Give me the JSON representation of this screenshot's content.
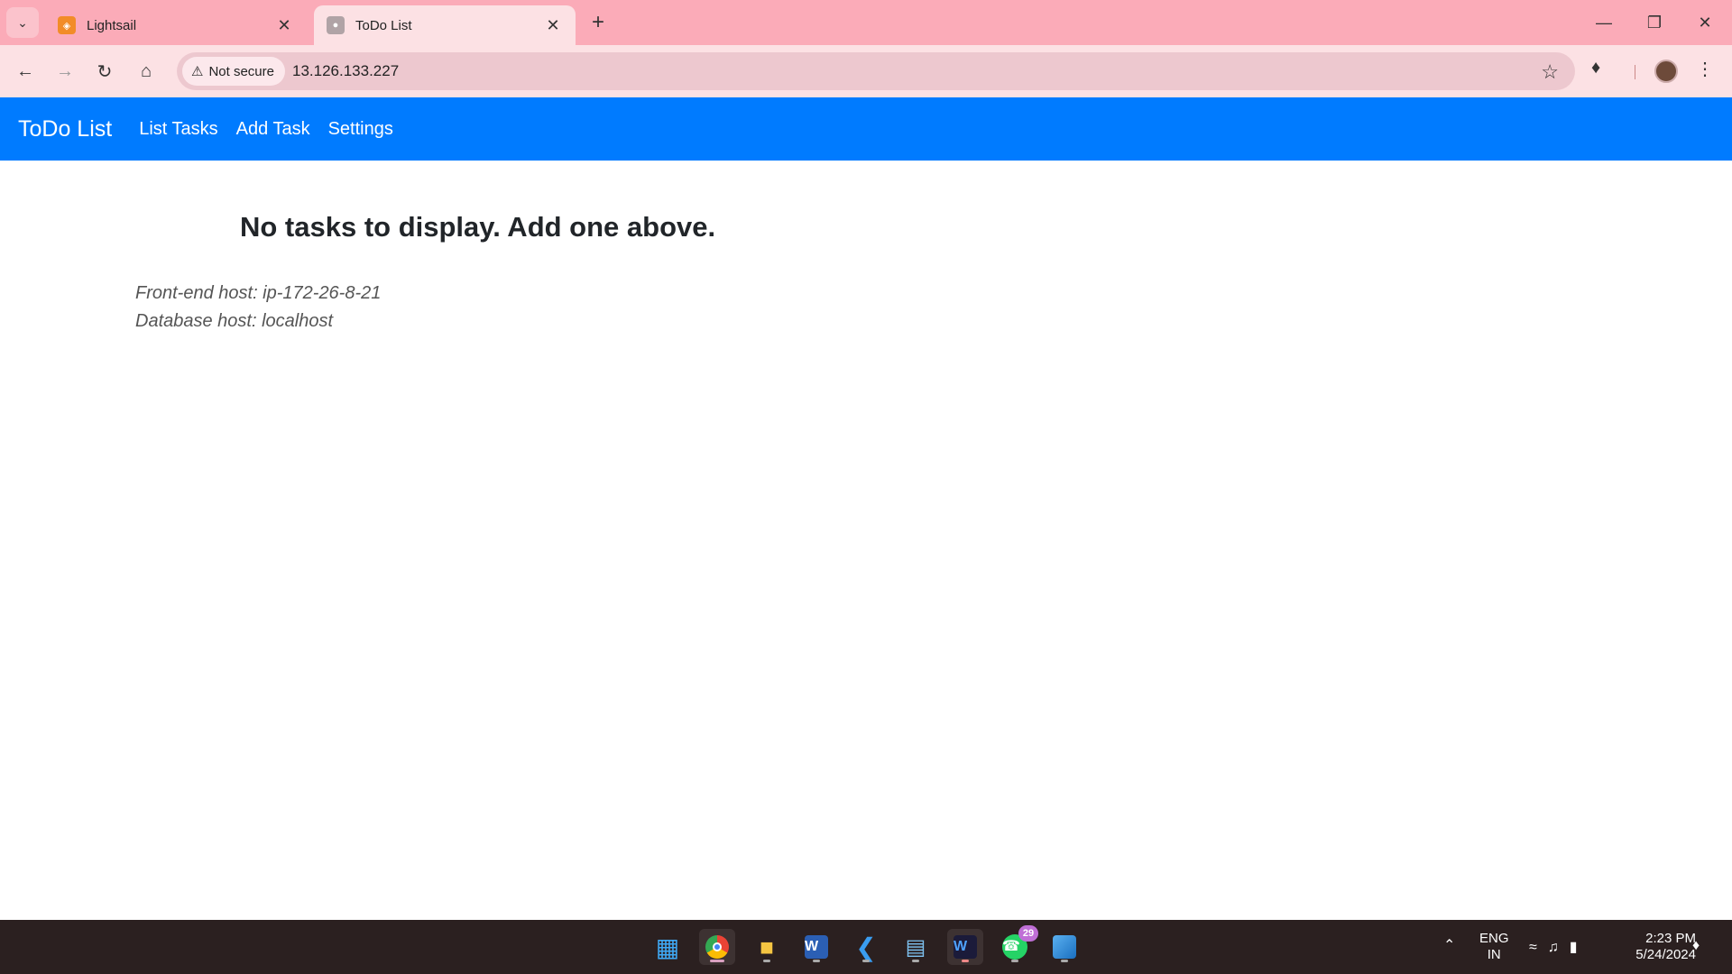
{
  "browser": {
    "tabs": [
      {
        "title": "Lightsail",
        "favicon": "lightsail-icon",
        "active": false
      },
      {
        "title": "ToDo List",
        "favicon": "globe-icon",
        "active": true
      }
    ],
    "security_label": "Not secure",
    "url": "13.126.133.227"
  },
  "navbar": {
    "brand": "ToDo List",
    "links": [
      "List Tasks",
      "Add Task",
      "Settings"
    ],
    "color": "#007bff"
  },
  "content": {
    "empty_message": "No tasks to display. Add one above.",
    "frontend_host": "Front-end host: ip-172-26-8-21",
    "database_host": "Database host: localhost"
  },
  "taskbar": {
    "apps": [
      "windows-start-icon",
      "chrome-icon",
      "file-explorer-icon",
      "word-icon",
      "vscode-icon",
      "notepad-icon",
      "app-w-icon",
      "whatsapp-icon",
      "photos-icon"
    ],
    "whatsapp_badge": "29",
    "language_line1": "ENG",
    "language_line2": "IN",
    "time": "2:23 PM",
    "date": "5/24/2024"
  }
}
